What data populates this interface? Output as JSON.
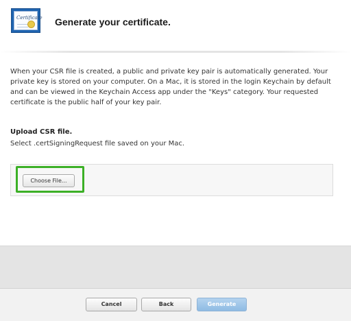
{
  "header": {
    "icon": "certificate-icon",
    "icon_text": "Certificate",
    "title": "Generate your certificate."
  },
  "main": {
    "description": "When your CSR file is created, a public and private key pair is automatically generated. Your private key is stored on your computer. On a Mac, it is stored in the login Keychain by default and can be viewed in the Keychain Access app under the \"Keys\" category. Your requested certificate is the public half of your key pair.",
    "upload_heading": "Upload CSR file.",
    "upload_subtext": "Select .certSigningRequest file saved on your Mac.",
    "choose_file_label": "Choose File..."
  },
  "footer": {
    "cancel_label": "Cancel",
    "back_label": "Back",
    "generate_label": "Generate",
    "generate_disabled": true
  },
  "colors": {
    "highlight": "#3cb026",
    "generate_button": "#9ec4e8",
    "footer_band": "#e4e4e4"
  }
}
